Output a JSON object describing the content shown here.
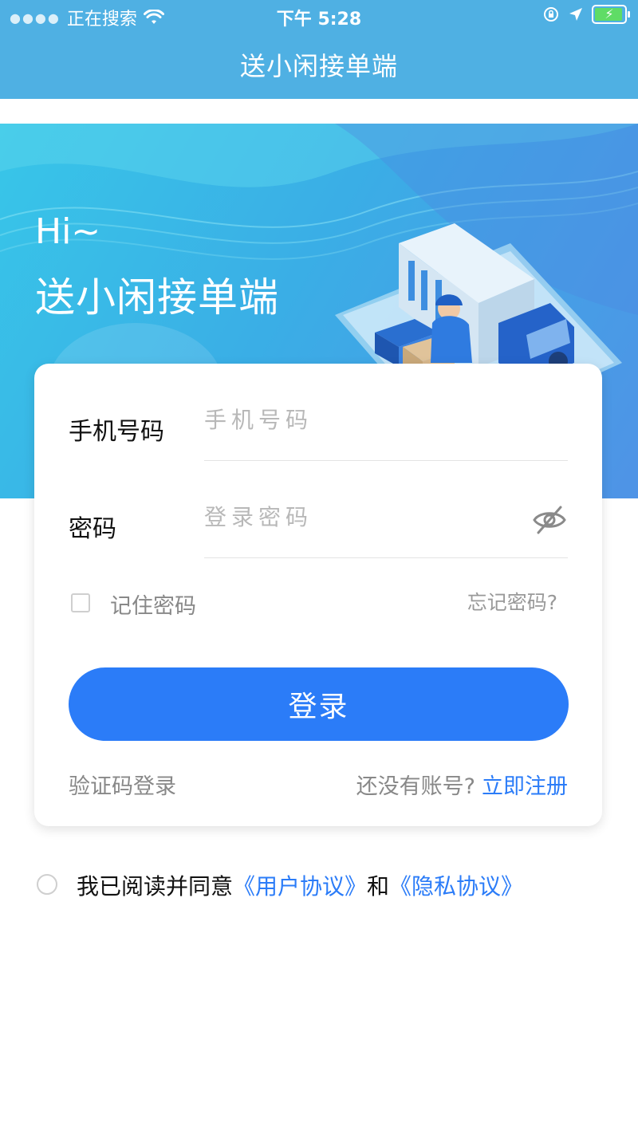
{
  "status_bar": {
    "carrier": "正在搜索",
    "time": "下午 5:28"
  },
  "nav": {
    "title": "送小闲接单端"
  },
  "banner": {
    "greeting": "Hi~",
    "title": "送小闲接单端"
  },
  "login_form": {
    "phone_label": "手机号码",
    "phone_placeholder": "手机号码",
    "password_label": "密码",
    "password_placeholder": "登录密码",
    "remember_label": "记住密码",
    "forgot_label": "忘记密码?",
    "login_button": "登录",
    "sms_login": "验证码登录",
    "no_account": "还没有账号?",
    "register_link": "立即注册"
  },
  "agreement": {
    "prefix": "我已阅读并同意",
    "user_agreement": "《用户协议》",
    "and": "和",
    "privacy_agreement": "《隐私协议》"
  },
  "colors": {
    "nav_bg": "#4fb0e3",
    "primary": "#2b7cf8"
  }
}
